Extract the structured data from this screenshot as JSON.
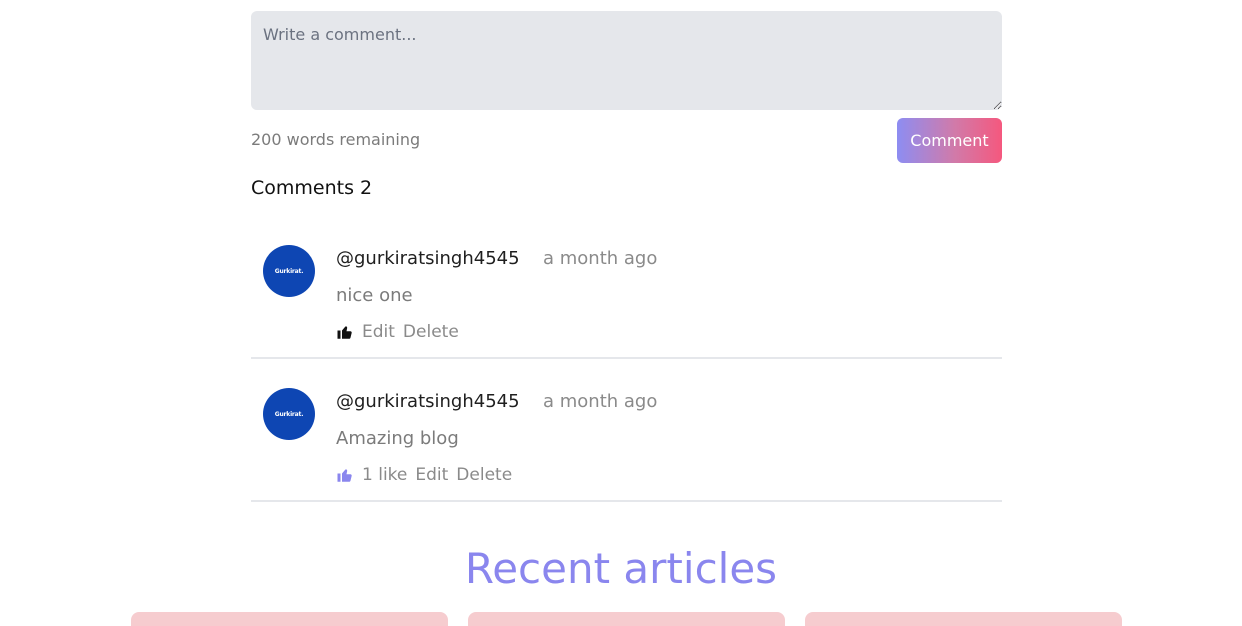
{
  "composer": {
    "placeholder": "Write a comment...",
    "words_remaining": "200 words remaining",
    "submit_label": "Comment"
  },
  "comments_heading": "Comments 2",
  "comments": [
    {
      "avatar_text": "Gurkirat.",
      "username": "@gurkiratsingh4545",
      "time": "a month ago",
      "text": "nice one",
      "like_label": "",
      "edit_label": "Edit",
      "delete_label": "Delete",
      "liked": true
    },
    {
      "avatar_text": "Gurkirat.",
      "username": "@gurkiratsingh4545",
      "time": "a month ago",
      "text": "Amazing blog",
      "like_label": "1 like",
      "edit_label": "Edit",
      "delete_label": "Delete",
      "liked": false
    }
  ],
  "recent_title": "Recent articles",
  "colors": {
    "accent": "#8a86ee",
    "button_gradient_start": "#8d8df2",
    "button_gradient_end": "#f5587e",
    "avatar_bg": "#0e46b3",
    "card_bg": "#f6cccf",
    "thumb_active": "#111111",
    "thumb_inactive": "#8a86ee"
  },
  "icons": {
    "like": "thumbs-up-icon"
  }
}
